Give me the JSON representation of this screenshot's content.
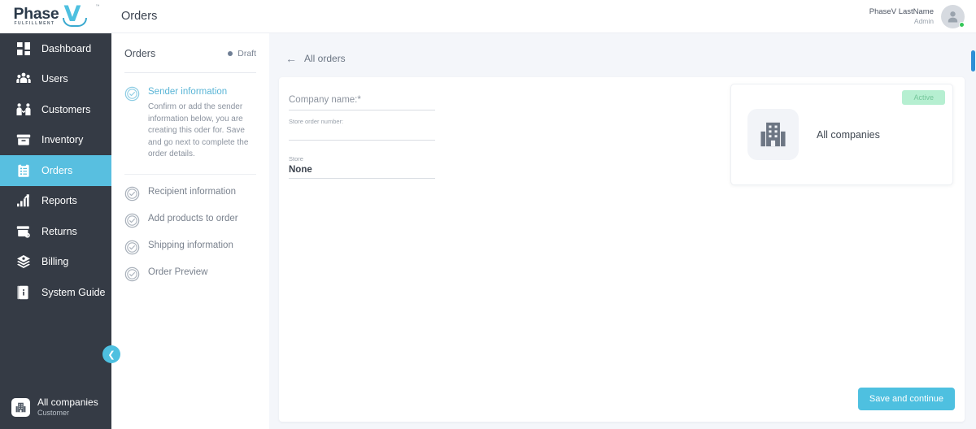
{
  "brand": {
    "logo_text": "Phase",
    "logo_mark": "V",
    "logo_tagline": "FULFILLMENT",
    "logo_tm": "™",
    "accent_color": "#4ec0e0",
    "sidebar_color": "#353b45",
    "active_nav_color": "#58bfe0",
    "badge_color": "#b6efd1"
  },
  "sidebar": {
    "items": [
      {
        "label": "Dashboard",
        "icon": "grid-icon",
        "active": false
      },
      {
        "label": "Users",
        "icon": "users-icon",
        "active": false
      },
      {
        "label": "Customers",
        "icon": "customers-icon",
        "active": false
      },
      {
        "label": "Inventory",
        "icon": "inventory-box-icon",
        "active": false
      },
      {
        "label": "Orders",
        "icon": "clipboard-orders-icon",
        "active": true
      },
      {
        "label": "Reports",
        "icon": "bar-chart-icon",
        "active": false
      },
      {
        "label": "Returns",
        "icon": "return-box-icon",
        "active": false
      },
      {
        "label": "Billing",
        "icon": "layers-billing-icon",
        "active": false
      },
      {
        "label": "System Guide",
        "icon": "book-icon",
        "active": false
      }
    ],
    "collapse_icon": "chevron-left-icon",
    "footer": {
      "icon": "building-icon",
      "name": "All companies",
      "role": "Customer"
    }
  },
  "header": {
    "title": "Orders",
    "user": {
      "name": "PhaseV LastName",
      "role": "Admin",
      "avatar_icon": "user-avatar-icon",
      "status": "online"
    }
  },
  "steps_panel": {
    "title": "Orders",
    "status": "Draft",
    "status_dot_color": "#6f7f95",
    "steps": [
      {
        "label": "Sender information",
        "icon": "check-circle-icon",
        "current": true,
        "description": "Confirm or add the sender information below, you are creating this oder for. Save and go next to complete the order details."
      },
      {
        "label": "Recipient information",
        "icon": "check-circle-icon",
        "current": false
      },
      {
        "label": "Add products to order",
        "icon": "check-circle-icon",
        "current": false
      },
      {
        "label": "Shipping information",
        "icon": "check-circle-icon",
        "current": false
      },
      {
        "label": "Order Preview",
        "icon": "check-circle-icon",
        "current": false
      }
    ]
  },
  "main": {
    "back_link": "All orders",
    "back_icon": "arrow-left-icon",
    "fields": [
      {
        "label": "Company name:*",
        "value": "",
        "style": "large"
      },
      {
        "label": "Store order number:",
        "value": "",
        "style": "small"
      },
      {
        "label": "Store",
        "value": "None",
        "style": "small"
      }
    ],
    "company_card": {
      "badge": "Active",
      "icon": "building-icon",
      "name": "All companies"
    },
    "primary_button": "Save and continue"
  }
}
